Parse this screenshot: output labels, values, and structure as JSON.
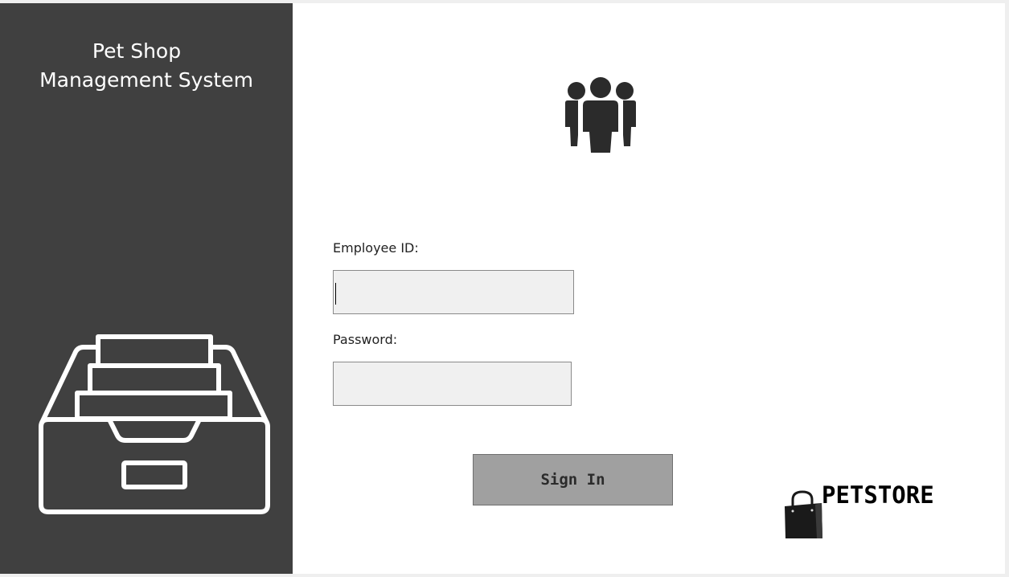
{
  "sidebar": {
    "title_line1": "Pet Shop",
    "title_line2": "Management System",
    "icon": "file-drawer-icon"
  },
  "header": {
    "icon": "users-group-icon"
  },
  "form": {
    "employee_id_label": "Employee ID:",
    "employee_id_value": "",
    "password_label": "Password:",
    "password_value": "",
    "sign_in_label": "Sign In"
  },
  "logo": {
    "icon": "shopping-bag-icon",
    "text": "PETSTORE"
  },
  "colors": {
    "sidebar_bg": "#404040",
    "content_bg": "#ffffff",
    "input_bg": "#f0f0f0",
    "button_bg": "#a0a0a0",
    "icon_dark": "#2b2b2b"
  }
}
